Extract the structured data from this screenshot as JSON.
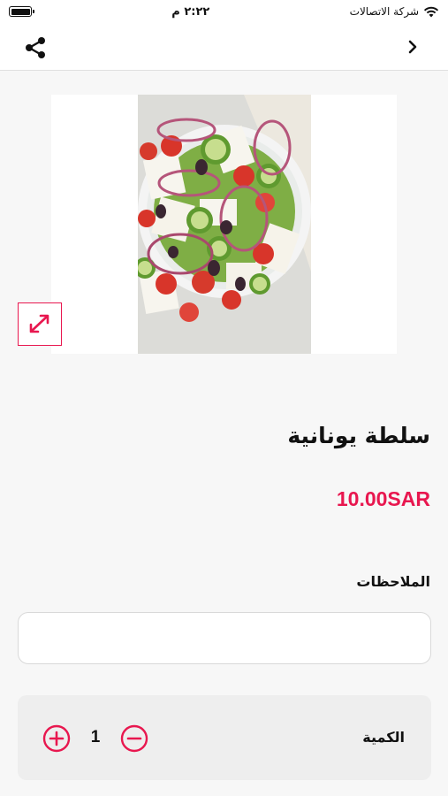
{
  "status_bar": {
    "time": "٢:٢٢ م",
    "carrier": "شركة الاتصالات",
    "battery_icon": "battery-icon",
    "wifi_icon": "wifi-icon"
  },
  "nav": {
    "share_icon": "share-icon",
    "back_icon": "chevron-right-icon"
  },
  "product": {
    "image_description": "greek-salad-photo",
    "expand_icon": "expand-icon",
    "name": "سلطة يونانية",
    "price": "10.00SAR"
  },
  "notes": {
    "label": "الملاحظات",
    "value": "",
    "placeholder": ""
  },
  "quantity": {
    "label": "الكمية",
    "value": "1",
    "plus_icon": "plus-circle-icon",
    "minus_icon": "minus-circle-icon"
  },
  "colors": {
    "accent": "#e8174f",
    "background": "#f7f7f7",
    "card": "#eeeeee"
  }
}
